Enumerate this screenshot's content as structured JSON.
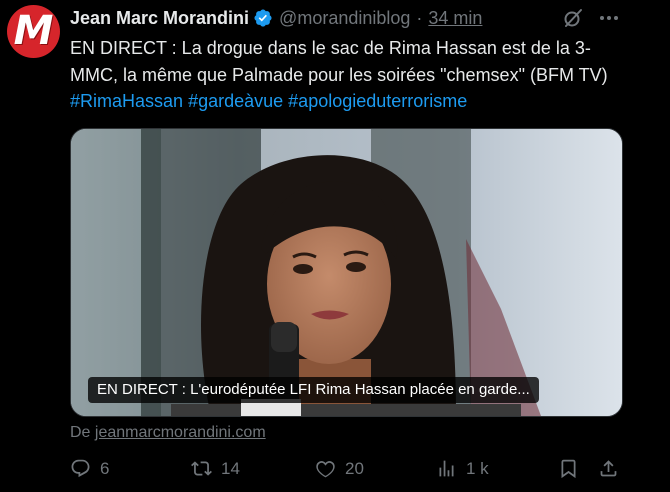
{
  "author": {
    "avatar_letter": "M",
    "name": "Jean Marc Morandini",
    "handle": "@morandiniblog",
    "separator": "·",
    "time": "34 min"
  },
  "tweet": {
    "text": "EN DIRECT : La drogue dans le sac de Rima Hassan est de la 3-MMC, la même que Palmade pour les soirées \"chemsex\" (BFM TV)",
    "hashtags": [
      "#RimaHassan",
      "#gardeàvue",
      "#apologieduterrorisme"
    ]
  },
  "media": {
    "caption": "EN DIRECT : L'eurodéputée LFI Rima Hassan placée en garde..."
  },
  "source": {
    "prefix": "De",
    "domain": "jeanmarcmorandini.com"
  },
  "actions": {
    "replies": "6",
    "reposts": "14",
    "likes": "20",
    "views": "1 k"
  },
  "colors": {
    "background": "#000000",
    "text": "#e7e9ea",
    "muted": "#71767b",
    "link": "#1d9bf0",
    "verified": "#1d9bf0",
    "avatar": "#d6252b"
  }
}
